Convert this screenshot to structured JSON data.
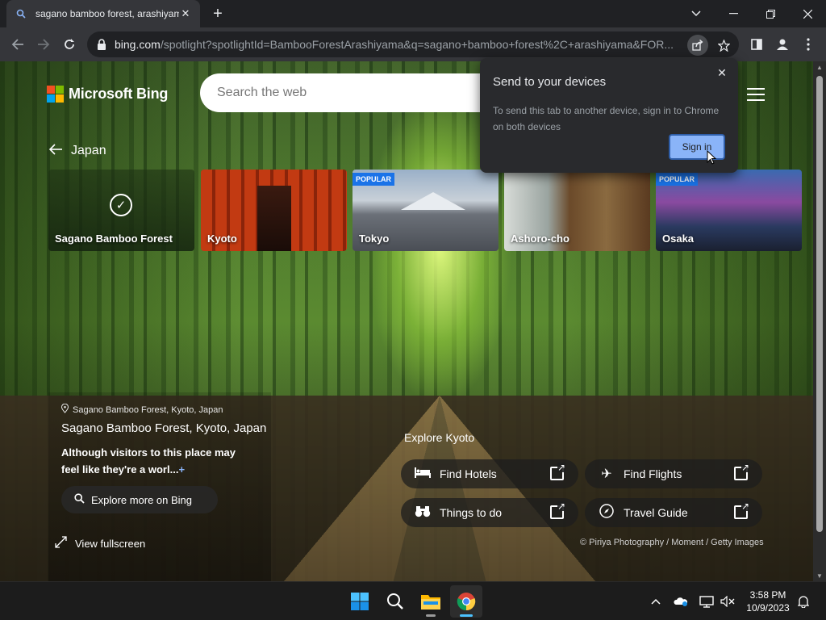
{
  "browser": {
    "tab_title": "sagano bamboo forest, arashiyama",
    "url_host": "bing.com",
    "url_path": "/spotlight?spotlightId=BambooForestArashiyama&q=sagano+bamboo+forest%2C+arashiyama&FOR..."
  },
  "bing": {
    "logo_text": "Microsoft Bing",
    "search_placeholder": "Search the web"
  },
  "breadcrumb": {
    "label": "Japan"
  },
  "cards": [
    {
      "caption": "Sagano Bamboo Forest",
      "badge": "",
      "selected": true
    },
    {
      "caption": "Kyoto",
      "badge": ""
    },
    {
      "caption": "Tokyo",
      "badge": "POPULAR"
    },
    {
      "caption": "Ashoro-cho",
      "badge": ""
    },
    {
      "caption": "Osaka",
      "badge": "POPULAR"
    }
  ],
  "info": {
    "location_line": "Sagano Bamboo Forest, Kyoto, Japan",
    "title": "Sagano Bamboo Forest, Kyoto, Japan",
    "description": "Although visitors to this place may feel like they're a worl...",
    "explore_label": "Explore more on Bing",
    "fullscreen_label": "View fullscreen"
  },
  "explore": {
    "title": "Explore Kyoto",
    "buttons": [
      {
        "label": "Find Hotels"
      },
      {
        "label": "Find Flights"
      },
      {
        "label": "Things to do"
      },
      {
        "label": "Travel Guide"
      }
    ]
  },
  "credit": "© Piriya Photography / Moment / Getty Images",
  "popup": {
    "title": "Send to your devices",
    "description": "To send this tab to another device, sign in to Chrome on both devices",
    "button": "Sign in"
  },
  "taskbar": {
    "time": "3:58 PM",
    "date": "10/9/2023"
  },
  "colors": {
    "accent": "#8ab4f8",
    "badge": "#1a73e8",
    "ms_red": "#f25022",
    "ms_green": "#7fba00",
    "ms_blue": "#00a4ef",
    "ms_yellow": "#ffb900"
  }
}
